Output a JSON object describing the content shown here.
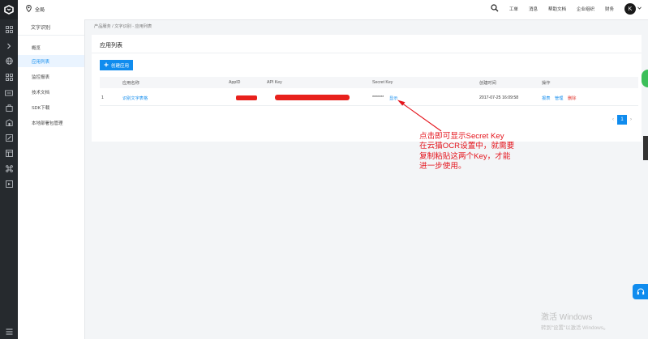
{
  "topbar": {
    "region_label": "全局",
    "nav": [
      "工单",
      "消息",
      "帮助文档",
      "企业组织",
      "财务"
    ],
    "avatar_letter": "K"
  },
  "icon_rail": {
    "icons": [
      "grid-icon",
      "chevron-right-icon",
      "globe-icon",
      "grid-icon",
      "card-icon",
      "box-icon",
      "building-icon",
      "edit-icon",
      "panel-icon",
      "nodes-icon",
      "image-icon"
    ],
    "bottom_icon": "menu-icon"
  },
  "sidebar": {
    "title": "文字识别",
    "items": [
      {
        "label": "概览",
        "active": false
      },
      {
        "label": "应用列表",
        "active": true
      },
      {
        "label": "监控报表",
        "active": false
      },
      {
        "label": "技术文档",
        "active": false
      },
      {
        "label": "SDK下载",
        "active": false
      },
      {
        "label": "本地部署包管理",
        "active": false
      }
    ]
  },
  "breadcrumb": "产品服务 / 文字识别 - 应用列表",
  "card": {
    "title": "应用列表",
    "create_button": "创建应用",
    "columns": [
      "应用名称",
      "AppID",
      "API Key",
      "Secret Key",
      "创建时间",
      "操作"
    ],
    "rows": [
      {
        "index": "1",
        "name": "识别文字表格",
        "secret_mask": "*******",
        "secret_show": "显示",
        "created": "2017-07-25 16:09:58",
        "actions": [
          "报表",
          "管理",
          "删除"
        ]
      }
    ],
    "pager": {
      "prev": "‹",
      "current": "1",
      "next": "›"
    }
  },
  "annotation": "点击即可显示Secret Key\n在云猫OCR设置中，就需要\n复制粘贴这两个Key，才能\n进一步使用。",
  "watermark": {
    "line1": "激活 Windows",
    "line2": "转到\"设置\"以激活 Windows。"
  },
  "colors": {
    "accent": "#108cee",
    "annotation": "#e4141c",
    "redaction": "#e8211c",
    "rail": "#262a2e"
  }
}
